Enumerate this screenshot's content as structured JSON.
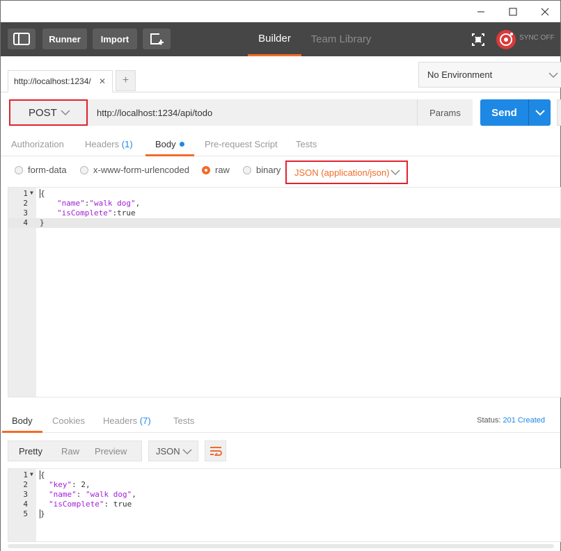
{
  "window": {
    "minimize_glyph": "—",
    "maximize_glyph": "☐",
    "close_glyph": "✕"
  },
  "header": {
    "runner_label": "Runner",
    "import_label": "Import",
    "tabs": [
      {
        "label": "Builder",
        "active": true
      },
      {
        "label": "Team Library",
        "active": false
      }
    ],
    "sync_label": "SYNC OFF",
    "accent_color": "#f26b2a"
  },
  "tabs": {
    "request_tab_label": "http://localhost:1234/",
    "close_glyph": "✕",
    "add_glyph": "+",
    "environment_label": "No Environment"
  },
  "request": {
    "method": "POST",
    "url": "http://localhost:1234/api/todo",
    "params_label": "Params",
    "send_label": "Send",
    "send_color": "#1e88e5"
  },
  "request_tabs": {
    "authorization": "Authorization",
    "headers": "Headers",
    "headers_count": "(1)",
    "body": "Body",
    "prerequest": "Pre-request Script",
    "tests": "Tests"
  },
  "body_types": {
    "form_data": "form-data",
    "urlencoded": "x-www-form-urlencoded",
    "raw": "raw",
    "binary": "binary",
    "selected": "raw",
    "content_type": "JSON (application/json)"
  },
  "request_body": {
    "lines": [
      {
        "num": "1",
        "text": "{"
      },
      {
        "num": "2",
        "key": "\"name\"",
        "sep": ":",
        "val": "\"walk dog\"",
        "tail": ","
      },
      {
        "num": "3",
        "key": "\"isComplete\"",
        "sep": ":",
        "val": "true",
        "tail": ""
      },
      {
        "num": "4",
        "text": "}"
      }
    ]
  },
  "response_tabs": {
    "body": "Body",
    "cookies": "Cookies",
    "headers": "Headers",
    "headers_count": "(7)",
    "tests": "Tests",
    "status_label": "Status:",
    "status_value": "201 Created",
    "status_color": "#1e88e5"
  },
  "response_view": {
    "pretty": "Pretty",
    "raw": "Raw",
    "preview": "Preview",
    "format": "JSON"
  },
  "response_body": {
    "lines": [
      {
        "num": "1",
        "text": "{"
      },
      {
        "num": "2",
        "key": "\"key\"",
        "sep": ": ",
        "val": "2",
        "tail": ","
      },
      {
        "num": "3",
        "key": "\"name\"",
        "sep": ": ",
        "val": "\"walk dog\"",
        "tail": ","
      },
      {
        "num": "4",
        "key": "\"isComplete\"",
        "sep": ": ",
        "val": "true",
        "tail": ""
      },
      {
        "num": "5",
        "text": "}"
      }
    ]
  }
}
